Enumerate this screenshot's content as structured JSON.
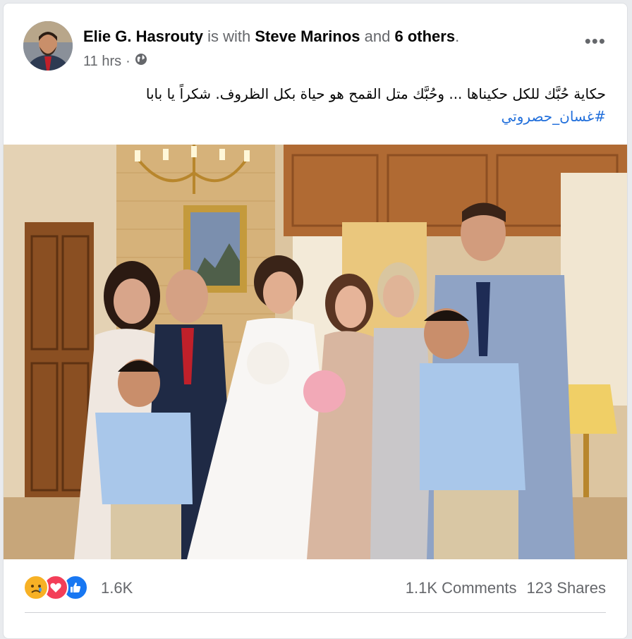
{
  "post": {
    "author": "Elie G. Hasrouty",
    "with_text": "is with",
    "tagged": "Steve Marinos",
    "and_text": "and",
    "others": "6 others",
    "period": ".",
    "time": "11 hrs",
    "separator": "·",
    "privacy_icon": "globe-icon",
    "more_label": "•••",
    "text": "حكاية حُبَّك للكل حكيناها ... وحُبَّك متل القمح هو حياة بكل الظروف. شكراً يا بابا",
    "hashtag": "#غسان_حصروتي"
  },
  "reactions": {
    "icons": [
      "sad-react-icon",
      "love-react-icon",
      "like-react-icon"
    ],
    "count": "1.6K",
    "comments": "1.1K Comments",
    "shares": "123 Shares"
  },
  "colors": {
    "accent": "#216fdb",
    "like": "#1877f2",
    "love": "#f33e58",
    "sad": "#f7b125"
  }
}
